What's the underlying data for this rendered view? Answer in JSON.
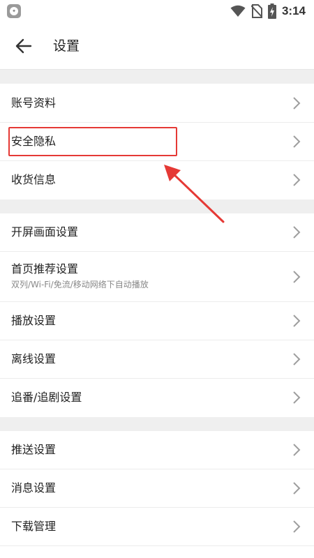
{
  "status_bar": {
    "time": "3:14",
    "app_icon": "app-notification-icon",
    "icons": [
      "wifi-icon",
      "no-sim-icon",
      "battery-charging-icon"
    ]
  },
  "header": {
    "back_icon": "arrow-left-icon",
    "title": "设置"
  },
  "groups": [
    {
      "items": [
        {
          "label": "账号资料"
        },
        {
          "label": "安全隐私",
          "highlighted": true
        },
        {
          "label": "收货信息"
        }
      ]
    },
    {
      "items": [
        {
          "label": "开屏画面设置"
        },
        {
          "label": "首页推荐设置",
          "subtitle": "双列/Wi-Fi/免流/移动网络下自动播放"
        },
        {
          "label": "播放设置"
        },
        {
          "label": "离线设置"
        },
        {
          "label": "追番/追剧设置"
        }
      ]
    },
    {
      "items": [
        {
          "label": "推送设置"
        },
        {
          "label": "消息设置"
        },
        {
          "label": "下载管理"
        }
      ]
    }
  ],
  "annotation": {
    "highlight_color": "#e53935",
    "pointer": "red-arrow-pointing-to-安全隐私"
  },
  "colors": {
    "background": "#ffffff",
    "section_gap": "#efefef",
    "divider": "#ececec",
    "text": "#222222",
    "subtext": "#888888",
    "chevron": "#9e9e9e"
  }
}
